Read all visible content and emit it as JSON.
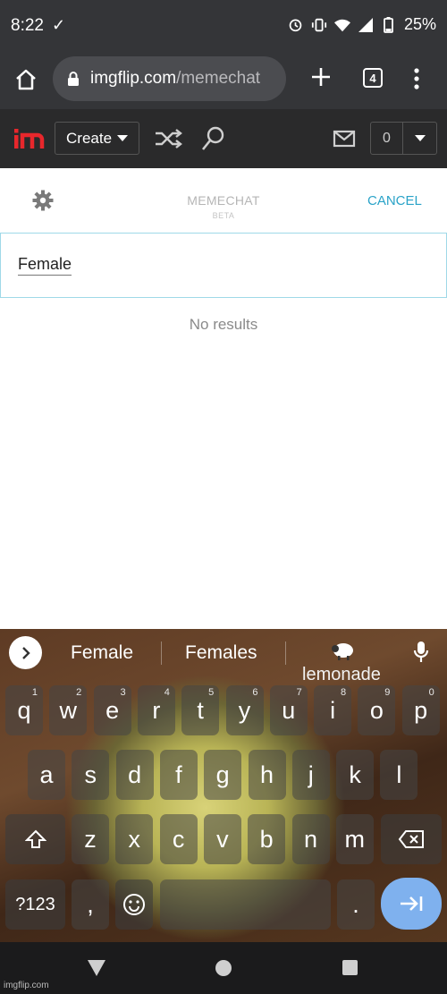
{
  "status_bar": {
    "time": "8:22",
    "battery": "25%",
    "icons": [
      "check-icon",
      "alarm-icon",
      "vibrate-icon",
      "wifi-icon",
      "signal-icon",
      "battery-icon"
    ]
  },
  "browser": {
    "url_host": "imgflip.com",
    "url_path": "/memechat",
    "tab_count": "4"
  },
  "site_header": {
    "create_label": "Create",
    "notification_count": "0"
  },
  "chat": {
    "title": "MEMECHAT",
    "beta": "BETA",
    "cancel_label": "CANCEL",
    "search_value": "Female",
    "empty_text": "No results"
  },
  "keyboard": {
    "suggestions": [
      "Female",
      "Females"
    ],
    "sticker_label": "lemonade",
    "row1": [
      {
        "k": "q",
        "n": "1"
      },
      {
        "k": "w",
        "n": "2"
      },
      {
        "k": "e",
        "n": "3"
      },
      {
        "k": "r",
        "n": "4"
      },
      {
        "k": "t",
        "n": "5"
      },
      {
        "k": "y",
        "n": "6"
      },
      {
        "k": "u",
        "n": "7"
      },
      {
        "k": "i",
        "n": "8"
      },
      {
        "k": "o",
        "n": "9"
      },
      {
        "k": "p",
        "n": "0"
      }
    ],
    "row2": [
      "a",
      "s",
      "d",
      "f",
      "g",
      "h",
      "j",
      "k",
      "l"
    ],
    "row3": [
      "z",
      "x",
      "c",
      "v",
      "b",
      "n",
      "m"
    ],
    "symbols_label": "?123",
    "comma": ",",
    "period": "."
  },
  "watermark": "imgflip.com",
  "colors": {
    "accent": "#2aa3c8",
    "logo_red": "#e8272c",
    "dark_bar": "#343538"
  }
}
